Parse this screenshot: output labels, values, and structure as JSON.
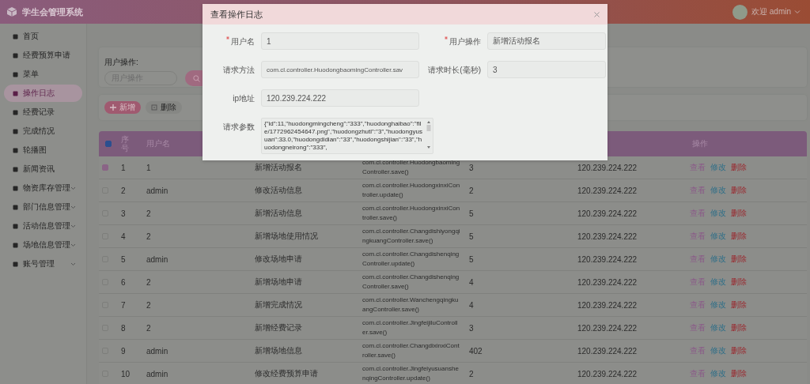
{
  "app": {
    "title": "学生会管理系统"
  },
  "user": {
    "greeting": "欢迎 admin"
  },
  "sidebar": {
    "items": [
      {
        "label": "首页",
        "kind": "link",
        "selected": false
      },
      {
        "label": "经费预算申请",
        "kind": "link",
        "selected": false
      },
      {
        "label": "菜单",
        "kind": "link",
        "selected": false
      },
      {
        "label": "操作日志",
        "kind": "link",
        "selected": true
      },
      {
        "label": "经费记录",
        "kind": "link",
        "selected": false
      },
      {
        "label": "完成情况",
        "kind": "link",
        "selected": false
      },
      {
        "label": "轮播图",
        "kind": "link",
        "selected": false
      },
      {
        "label": "新闻资讯",
        "kind": "link",
        "selected": false
      },
      {
        "label": "物资库存管理",
        "kind": "group",
        "selected": false,
        "expanded": false
      },
      {
        "label": "部门信息管理",
        "kind": "group",
        "selected": false,
        "expanded": false
      },
      {
        "label": "活动信息管理",
        "kind": "group",
        "selected": false,
        "expanded": false
      },
      {
        "label": "场地信息管理",
        "kind": "group",
        "selected": false,
        "expanded": false
      },
      {
        "label": "账号管理",
        "kind": "group",
        "selected": false,
        "expanded": false
      }
    ]
  },
  "search": {
    "label": "用户操作:",
    "placeholder": "用户操作"
  },
  "toolbar": {
    "add": "新增",
    "delete": "删除"
  },
  "table": {
    "select_all_indeterminate": true,
    "header": {
      "index": "序号",
      "username": "用户名",
      "actions": "操作"
    },
    "rows": [
      {
        "selected": true,
        "index": "1",
        "username": "1",
        "operation": "新增活动报名",
        "method": "com.cl.controller.HuodongbaomingController.save()",
        "duration": "3",
        "ip": "120.239.224.222",
        "actions": [
          "查看",
          "修改",
          "删除"
        ]
      },
      {
        "selected": false,
        "index": "2",
        "username": "admin",
        "operation": "修改活动信息",
        "method": "com.cl.controller.HuodongxinxiController.update()",
        "duration": "2",
        "ip": "120.239.224.222",
        "actions": [
          "查看",
          "修改",
          "删除"
        ]
      },
      {
        "selected": false,
        "index": "3",
        "username": "2",
        "operation": "新增活动信息",
        "method": "com.cl.controller.HuodongxinxiController.save()",
        "duration": "5",
        "ip": "120.239.224.222",
        "actions": [
          "查看",
          "修改",
          "删除"
        ]
      },
      {
        "selected": false,
        "index": "4",
        "username": "2",
        "operation": "新增场地使用情况",
        "method": "com.cl.controller.ChangdishiyongqingkuangController.save()",
        "duration": "5",
        "ip": "120.239.224.222",
        "actions": [
          "查看",
          "修改",
          "删除"
        ]
      },
      {
        "selected": false,
        "index": "5",
        "username": "admin",
        "operation": "修改场地申请",
        "method": "com.cl.controller.ChangdishenqingController.update()",
        "duration": "5",
        "ip": "120.239.224.222",
        "actions": [
          "查看",
          "修改",
          "删除"
        ]
      },
      {
        "selected": false,
        "index": "6",
        "username": "2",
        "operation": "新增场地申请",
        "method": "com.cl.controller.ChangdishenqingController.save()",
        "duration": "4",
        "ip": "120.239.224.222",
        "actions": [
          "查看",
          "修改",
          "删除"
        ]
      },
      {
        "selected": false,
        "index": "7",
        "username": "2",
        "operation": "新增完成情况",
        "method": "com.cl.controller.WanchengqingkuangController.save()",
        "duration": "4",
        "ip": "120.239.224.222",
        "actions": [
          "查看",
          "修改",
          "删除"
        ]
      },
      {
        "selected": false,
        "index": "8",
        "username": "2",
        "operation": "新增经费记录",
        "method": "com.cl.controller.JingfeijiluController.save()",
        "duration": "3",
        "ip": "120.239.224.222",
        "actions": [
          "查看",
          "修改",
          "删除"
        ]
      },
      {
        "selected": false,
        "index": "9",
        "username": "admin",
        "operation": "新增场地信息",
        "method": "com.cl.controller.ChangdixinxiController.save()",
        "duration": "402",
        "ip": "120.239.224.222",
        "actions": [
          "查看",
          "修改",
          "删除"
        ]
      },
      {
        "selected": false,
        "index": "10",
        "username": "admin",
        "operation": "修改经费预算申请",
        "method": "com.cl.controller.JingfeiyusuanshenqingController.update()",
        "duration": "2",
        "ip": "120.239.224.222",
        "actions": [
          "查看",
          "修改",
          "删除"
        ]
      }
    ]
  },
  "dialog": {
    "title": "查看操作日志",
    "fields": [
      {
        "kind": "input",
        "label": "用户名",
        "required": true,
        "value": "1"
      },
      {
        "kind": "input",
        "label": "用户操作",
        "required": true,
        "value": "新增活动报名"
      },
      {
        "kind": "input",
        "label": "请求方法",
        "required": false,
        "value": "com.cl.controller.HuodongbaomingController.sav"
      },
      {
        "kind": "input",
        "label": "请求时长(毫秒)",
        "required": false,
        "value": "3"
      },
      {
        "kind": "input",
        "label": "ip地址",
        "required": false,
        "value": "120.239.224.222"
      },
      {
        "kind": "textarea",
        "label": "请求参数",
        "required": false,
        "value": "{\"id\":11,\"huodongmingcheng\":\"333\",\"huodonghaibao\":\"file/1772962454647.png\",\"huodongzhuti\":\"3\",\"huodongyusuan\":33.0,\"huodongdidian\":\"33\",\"huodongshijian\":\"33\",\"huodongneirong\":\"333\","
      }
    ]
  }
}
